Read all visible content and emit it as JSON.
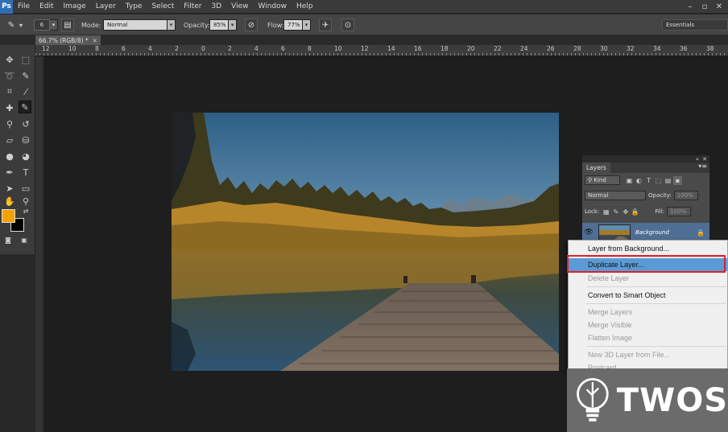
{
  "app": {
    "logo": "Ps"
  },
  "menu": [
    "File",
    "Edit",
    "Image",
    "Layer",
    "Type",
    "Select",
    "Filter",
    "3D",
    "View",
    "Window",
    "Help"
  ],
  "window_controls": [
    "minimize-icon",
    "maximize-icon",
    "close-icon"
  ],
  "options": {
    "brush_size": "6",
    "mode_label": "Mode:",
    "mode_value": "Normal",
    "opacity_label": "Opacity:",
    "opacity_value": "85%",
    "flow_label": "Flow:",
    "flow_value": "77%",
    "workspace": "Essentials"
  },
  "document_tab": {
    "title": "66.7% (RGB/8) *",
    "close": "×"
  },
  "ruler": {
    "labels": [
      "12",
      "10",
      "8",
      "6",
      "4",
      "2",
      "0",
      "2",
      "4",
      "6",
      "8",
      "10",
      "12",
      "14",
      "16",
      "18",
      "20",
      "22",
      "24",
      "26",
      "28",
      "30",
      "32",
      "34",
      "36",
      "38"
    ]
  },
  "colors": {
    "foreground": "#f5a000",
    "background": "#000000",
    "accent_highlight": "#5b9bd5",
    "annotation_box": "#e0202e"
  },
  "layers_panel": {
    "tab": "Layers",
    "filter_kind": "Kind",
    "blend_mode": "Normal",
    "opacity_label": "Opacity:",
    "opacity_value": "100%",
    "lock_label": "Lock:",
    "fill_label": "Fill:",
    "fill_value": "100%",
    "layer_name": "Background"
  },
  "context_menu": {
    "items": [
      {
        "label": "Layer from Background...",
        "enabled": true
      },
      {
        "label": "Duplicate Layer...",
        "enabled": true,
        "highlighted": true
      },
      {
        "label": "Delete Layer",
        "enabled": false
      },
      {
        "label": "Convert to Smart Object",
        "enabled": true
      },
      {
        "label": "Merge Layers",
        "enabled": false
      },
      {
        "label": "Merge Visible",
        "enabled": false
      },
      {
        "label": "Flatten Image",
        "enabled": false
      },
      {
        "label": "New 3D Layer from File...",
        "enabled": false
      },
      {
        "label": "Postcard",
        "enabled": false
      }
    ]
  },
  "watermark": {
    "text": "TWOS"
  }
}
